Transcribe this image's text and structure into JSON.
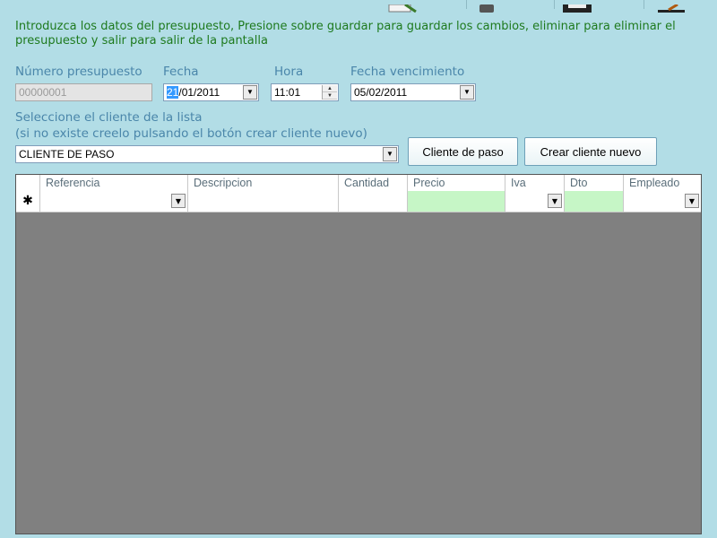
{
  "instructions": "Introduzca los datos del presupuesto, Presione sobre guardar para guardar los cambios, eliminar para eliminar el presupuesto y salir para salir de la pantalla",
  "form": {
    "numero_label": "Número presupuesto",
    "numero_value": "00000001",
    "fecha_label": "Fecha",
    "fecha_day": "21",
    "fecha_rest": "/01/2011",
    "hora_label": "Hora",
    "hora_value": "11:01",
    "vencimiento_label": "Fecha vencimiento",
    "vencimiento_value": "05/02/2011",
    "cliente_label_1": "Seleccione el cliente de la lista",
    "cliente_label_2": "(si no existe creelo pulsando el botón crear cliente nuevo)",
    "cliente_value": "CLIENTE DE PASO",
    "btn_cliente_paso": "Cliente de paso",
    "btn_crear_cliente": "Crear cliente nuevo"
  },
  "grid": {
    "columns": [
      "Referencia",
      "Descripcion",
      "Cantidad",
      "Precio",
      "Iva",
      "Dto",
      "Empleado"
    ],
    "new_row_marker": "✱"
  },
  "colors": {
    "background": "#b2dde6",
    "instructions": "#1e7a1e",
    "label": "#4a86aa",
    "grid_bg": "#808080",
    "editable_cell": "#c6f6c6"
  },
  "icons": [
    "edit-icon",
    "delete-icon",
    "save-icon",
    "exit-icon",
    "dropdown-arrow-icon",
    "spinner-icon"
  ]
}
